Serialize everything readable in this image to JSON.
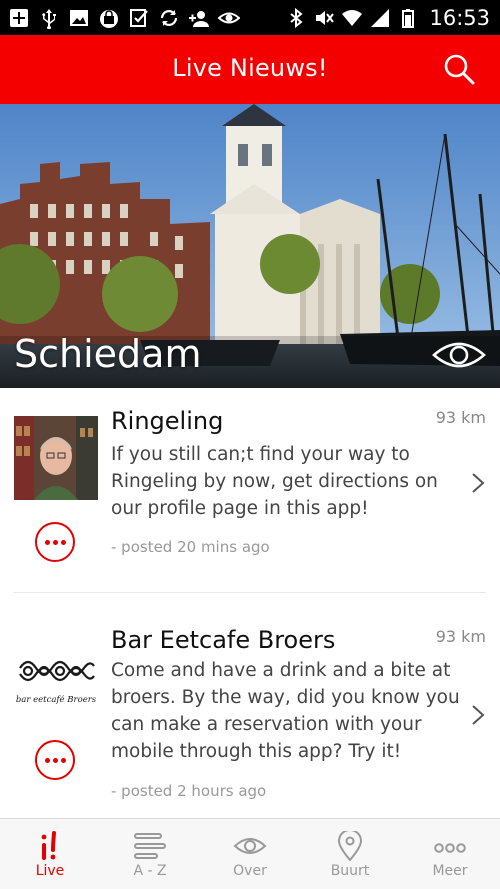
{
  "status_bar": {
    "time": "16:53",
    "left_icons": [
      "add-box-icon",
      "usb-icon",
      "image-icon",
      "bag-icon",
      "checklist-icon",
      "sync-icon",
      "add-person-icon",
      "eye-icon"
    ],
    "right_icons": [
      "bluetooth-icon",
      "mute-icon",
      "wifi-icon",
      "signal-icon",
      "battery-icon"
    ]
  },
  "header": {
    "title": "Live Nieuws!"
  },
  "hero": {
    "city": "Schiedam"
  },
  "feed": [
    {
      "title": "Ringeling",
      "distance": "93 km",
      "body": "If you still can;t find your way to Ringeling by now, get directions on our profile page in this app!",
      "time": "- posted 20 mins ago"
    },
    {
      "title": "Bar Eetcafe Broers",
      "distance": "93 km",
      "body": "Come and have a drink and a bite at broers. By the way, did you know you can make a reservation with your mobile through this app? Try it!",
      "time": "- posted 2 hours ago",
      "logo_text": "bar eetcafé Broers"
    }
  ],
  "nav": [
    {
      "label": "Live",
      "icon": "live-icon",
      "active": true
    },
    {
      "label": "A - Z",
      "icon": "list-icon",
      "active": false
    },
    {
      "label": "Over",
      "icon": "eye-icon",
      "active": false
    },
    {
      "label": "Buurt",
      "icon": "location-pin-icon",
      "active": false
    },
    {
      "label": "Meer",
      "icon": "more-icon",
      "active": false
    }
  ],
  "colors": {
    "brand_red": "#f50000",
    "accent_red": "#e30000"
  }
}
